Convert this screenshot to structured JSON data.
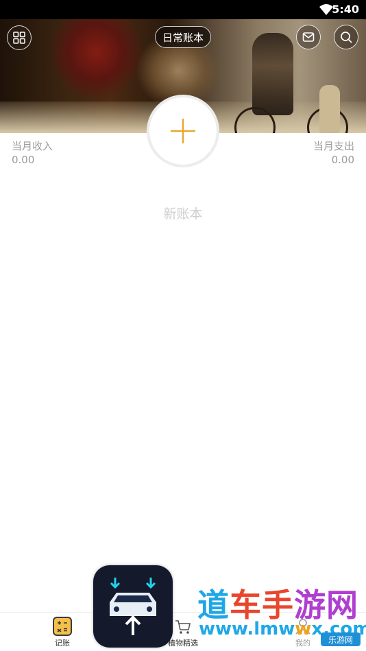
{
  "status_bar": {
    "time": "5:40"
  },
  "header": {
    "book_name": "日常账本",
    "grid_icon": "grid-icon",
    "mail_icon": "mail-icon",
    "search_icon": "search-icon",
    "add_icon": "plus-icon",
    "accent_color": "#e8a72c"
  },
  "summary": {
    "income_label": "当月收入",
    "income_value": "0.00",
    "expense_label": "当月支出",
    "expense_value": "0.00"
  },
  "main": {
    "new_book_label": "新账本"
  },
  "bottom_nav": {
    "items": [
      {
        "label": "记账",
        "icon": "calculator-icon"
      },
      {
        "label": "植物精选",
        "icon": "cart-icon"
      },
      {
        "label": "我的",
        "icon": "person-icon"
      }
    ]
  },
  "watermark": {
    "title_1": "道",
    "title_2": "车手",
    "title_3": "游网",
    "url_1": "www.lmw",
    "url_2": "w",
    "url_3": "x.com",
    "badge": "乐游网"
  }
}
